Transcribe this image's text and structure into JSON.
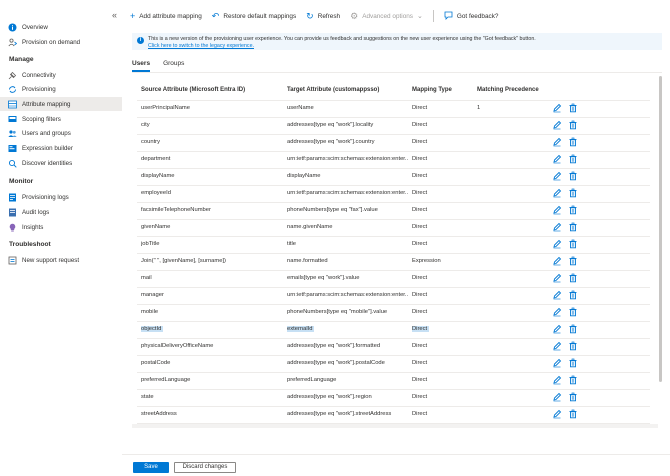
{
  "sidebar": {
    "collapse_glyph": "«",
    "top_items": [
      {
        "label": "Overview",
        "icon": "info-circle-icon"
      },
      {
        "label": "Provision on demand",
        "icon": "person-sync-icon"
      }
    ],
    "sections": [
      {
        "title": "Manage",
        "items": [
          {
            "label": "Connectivity",
            "icon": "plug-icon"
          },
          {
            "label": "Provisioning",
            "icon": "cycle-icon"
          },
          {
            "label": "Attribute mapping",
            "icon": "table-icon",
            "active": true
          },
          {
            "label": "Scoping filters",
            "icon": "filter-icon"
          },
          {
            "label": "Users and groups",
            "icon": "users-icon"
          },
          {
            "label": "Expression builder",
            "icon": "builder-icon"
          },
          {
            "label": "Discover identities",
            "icon": "search-person-icon"
          }
        ]
      },
      {
        "title": "Monitor",
        "items": [
          {
            "label": "Provisioning logs",
            "icon": "log-icon"
          },
          {
            "label": "Audit logs",
            "icon": "audit-icon"
          },
          {
            "label": "Insights",
            "icon": "bulb-icon"
          }
        ]
      },
      {
        "title": "Troubleshoot",
        "items": [
          {
            "label": "New support request",
            "icon": "support-icon"
          }
        ]
      }
    ]
  },
  "toolbar": {
    "add_label": "Add attribute mapping",
    "restore_label": "Restore default mappings",
    "refresh_label": "Refresh",
    "advanced_label": "Advanced options",
    "feedback_label": "Got feedback?"
  },
  "banner": {
    "message": "This is a new version of the provisioning user experience. You can provide us feedback and suggestions on the new user experience using the \"Got feedback\" button.",
    "link": "Click here to switch to the legacy experience."
  },
  "tabs": [
    {
      "label": "Users",
      "active": true
    },
    {
      "label": "Groups",
      "active": false
    }
  ],
  "table": {
    "headers": {
      "source": "Source Attribute (Microsoft Entra ID)",
      "target": "Target Attribute (customappsso)",
      "mapping": "Mapping Type",
      "precedence": "Matching Precedence"
    },
    "rows": [
      {
        "source": "userPrincipalName",
        "target": "userName",
        "mapping": "Direct",
        "precedence": "1"
      },
      {
        "source": "city",
        "target": "addresses[type eq \"work\"].locality",
        "mapping": "Direct",
        "precedence": ""
      },
      {
        "source": "country",
        "target": "addresses[type eq \"work\"].country",
        "mapping": "Direct",
        "precedence": ""
      },
      {
        "source": "department",
        "target": "urn:ietf:params:scim:schemas:extension:enter...",
        "mapping": "Direct",
        "precedence": ""
      },
      {
        "source": "displayName",
        "target": "displayName",
        "mapping": "Direct",
        "precedence": ""
      },
      {
        "source": "employeeId",
        "target": "urn:ietf:params:scim:schemas:extension:enter...",
        "mapping": "Direct",
        "precedence": ""
      },
      {
        "source": "facsimileTelephoneNumber",
        "target": "phoneNumbers[type eq \"fax\"].value",
        "mapping": "Direct",
        "precedence": ""
      },
      {
        "source": "givenName",
        "target": "name.givenName",
        "mapping": "Direct",
        "precedence": ""
      },
      {
        "source": "jobTitle",
        "target": "title",
        "mapping": "Direct",
        "precedence": ""
      },
      {
        "source": "Join(\" \", [givenName], [surname])",
        "target": "name.formatted",
        "mapping": "Expression",
        "precedence": ""
      },
      {
        "source": "mail",
        "target": "emails[type eq \"work\"].value",
        "mapping": "Direct",
        "precedence": ""
      },
      {
        "source": "manager",
        "target": "urn:ietf:params:scim:schemas:extension:enter...",
        "mapping": "Direct",
        "precedence": ""
      },
      {
        "source": "mobile",
        "target": "phoneNumbers[type eq \"mobile\"].value",
        "mapping": "Direct",
        "precedence": ""
      },
      {
        "source": "objectId",
        "target": "externalId",
        "mapping": "Direct",
        "precedence": "",
        "selected": true
      },
      {
        "source": "physicalDeliveryOfficeName",
        "target": "addresses[type eq \"work\"].formatted",
        "mapping": "Direct",
        "precedence": ""
      },
      {
        "source": "postalCode",
        "target": "addresses[type eq \"work\"].postalCode",
        "mapping": "Direct",
        "precedence": ""
      },
      {
        "source": "preferredLanguage",
        "target": "preferredLanguage",
        "mapping": "Direct",
        "precedence": ""
      },
      {
        "source": "state",
        "target": "addresses[type eq \"work\"].region",
        "mapping": "Direct",
        "precedence": ""
      },
      {
        "source": "streetAddress",
        "target": "addresses[type eq \"work\"].streetAddress",
        "mapping": "Direct",
        "precedence": ""
      }
    ]
  },
  "footer": {
    "save_label": "Save",
    "discard_label": "Discard changes"
  },
  "colors": {
    "accent": "#0078d4",
    "selection": "#c7e0f4",
    "nav_active": "#edebe9",
    "delete_icon": "#0078d4"
  }
}
